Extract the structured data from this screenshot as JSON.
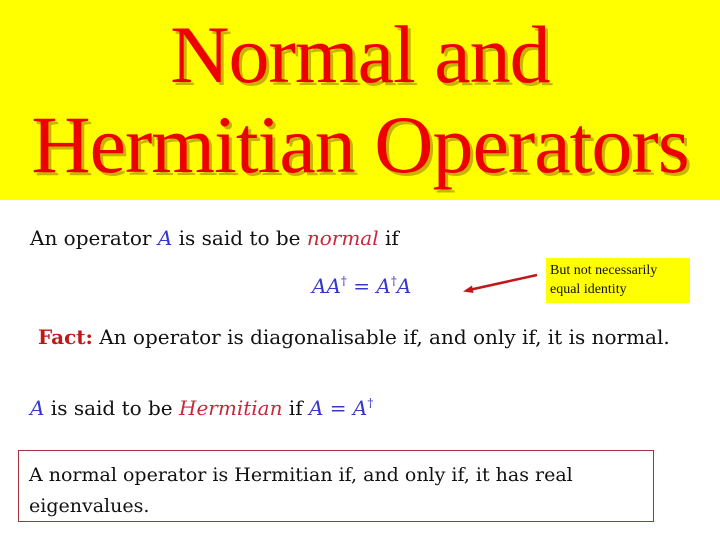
{
  "slide": {
    "title_line1": "Normal and",
    "title_line2": "Hermitian Operators",
    "colors": {
      "header_bg": "#ffff00",
      "title": "#ee0000",
      "math_blue": "#3838c8",
      "emphasis_red": "#c8283c",
      "box_border": "#a83038"
    }
  },
  "definition_normal": {
    "prefix": "An operator ",
    "symbol": "A",
    "middle": " is said to be ",
    "term": "normal",
    "suffix": " if"
  },
  "formula_normal": {
    "lhs_a": "A",
    "lhs_b": "A",
    "dagger": "†",
    "equals": " = ",
    "rhs_a": "A",
    "rhs_b": "A"
  },
  "callout": {
    "text_line1": "But not necessarily",
    "text_line2": "equal identity"
  },
  "fact": {
    "label": "Fact:",
    "text": " An operator is diagonalisable if, and only if, it is normal."
  },
  "definition_hermitian": {
    "symbol": "A",
    "middle": " is said to be ",
    "term": "Hermitian",
    "if_word": " if ",
    "eq_lhs": "A",
    "equals": " = ",
    "eq_rhs": "A",
    "dagger": "†"
  },
  "theorem": {
    "text": "A normal operator is Hermitian if, and only if, it has real eigenvalues."
  }
}
